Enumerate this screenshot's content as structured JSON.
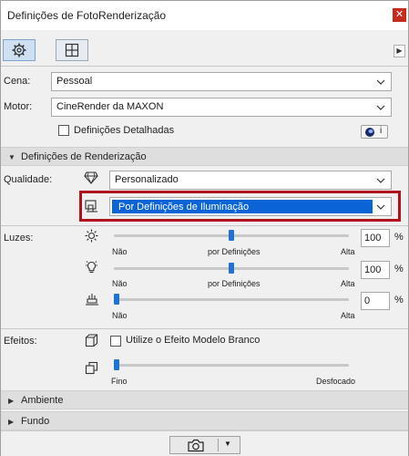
{
  "window": {
    "title": "Definições de FotoRenderização",
    "close_glyph": "✕"
  },
  "tabs": [
    {
      "icon": "gear-icon",
      "active": true
    },
    {
      "icon": "grid-view-icon",
      "active": false
    }
  ],
  "cena": {
    "label": "Cena:",
    "value": "Pessoal"
  },
  "motor": {
    "label": "Motor:",
    "value": "CineRender da MAXON"
  },
  "detalhadas": {
    "label": "Definições Detalhadas",
    "checked": false,
    "info_glyph": "i"
  },
  "render_section": {
    "title": "Definições de Renderização",
    "expanded": true
  },
  "qualidade": {
    "label": "Qualidade:",
    "value": "Personalizado"
  },
  "iluminacao": {
    "value": "Por Definições de Iluminação"
  },
  "luzes": {
    "label": "Luzes:",
    "sliders": [
      {
        "icon": "sun-icon",
        "min_label": "Não",
        "mid_label": "por Definições",
        "max_label": "Alta",
        "value": "100",
        "level": 0.5
      },
      {
        "icon": "bulb-icon",
        "min_label": "Não",
        "mid_label": "por Definições",
        "max_label": "Alta",
        "value": "100",
        "level": 0.5
      },
      {
        "icon": "ambient-light-icon",
        "min_label": "Não",
        "max_label": "Alta",
        "value": "0",
        "level": 0
      }
    ],
    "unit": "%"
  },
  "efeitos": {
    "label": "Efeitos:",
    "white_model": {
      "label": "Utilize o Efeito Modelo Branco",
      "checked": false
    },
    "blur": {
      "min_label": "Fino",
      "max_label": "Desfocado",
      "level": 0
    }
  },
  "sections": [
    {
      "title": "Ambiente",
      "expanded": false
    },
    {
      "title": "Fundo",
      "expanded": false
    }
  ],
  "colors": {
    "accent": "#1e72d8",
    "highlight_border": "#b0121b",
    "selection": "#0a64d6"
  }
}
